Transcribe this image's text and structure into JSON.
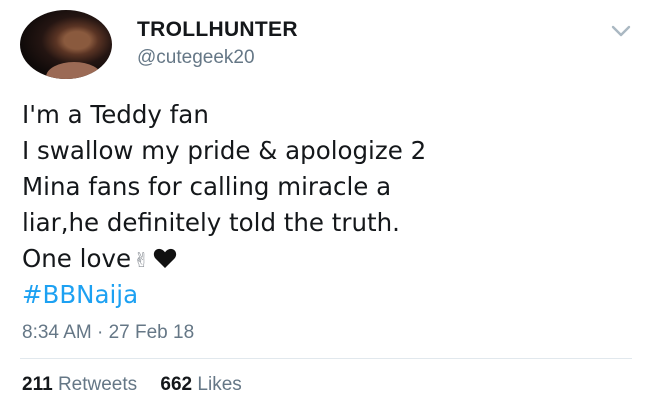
{
  "user": {
    "display_name": "TROLLHUNTER",
    "handle": "@cutegeek20"
  },
  "tweet": {
    "lines": [
      "I'm a Teddy fan",
      "I swallow my pride & apologize 2",
      "Mina fans for calling miracle a",
      "liar,he definitely told the truth.",
      "One love"
    ],
    "hashtag": "#BBNaija",
    "emoji": [
      "peace-sign",
      "black-heart"
    ]
  },
  "timestamp": "8:34 AM · 27 Feb 18",
  "stats": {
    "retweets_count": "211",
    "retweets_label": "Retweets",
    "likes_count": "662",
    "likes_label": "Likes"
  },
  "colors": {
    "text": "#14171a",
    "muted": "#657786",
    "link": "#1da1f2",
    "divider": "#e1e8ed"
  }
}
